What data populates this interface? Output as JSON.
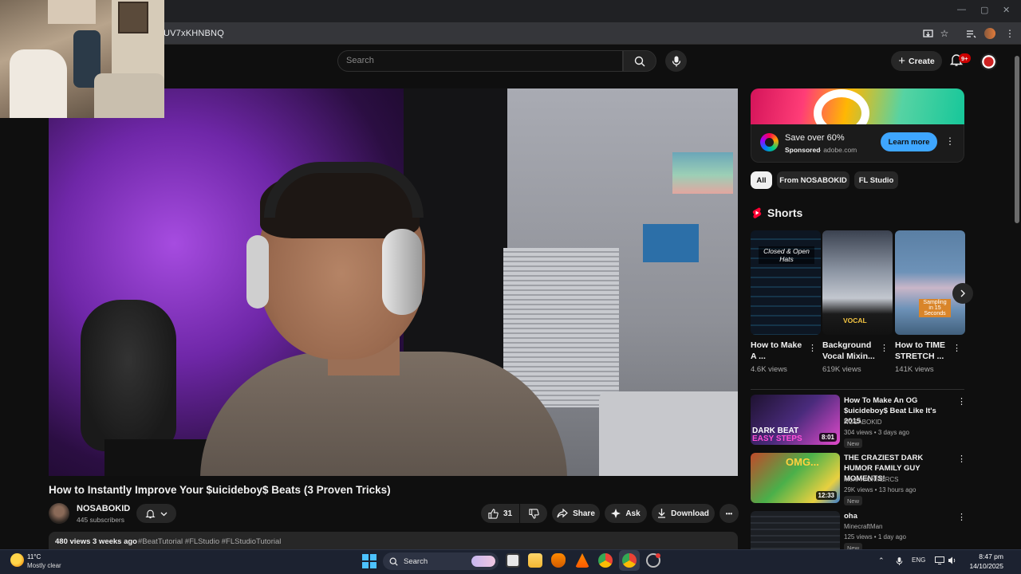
{
  "browser": {
    "url": "UV7xKHNBNQ",
    "window_controls": [
      "—",
      "▢",
      "✕"
    ]
  },
  "header": {
    "search_placeholder": "Search",
    "create_label": "Create",
    "notification_count": "9+"
  },
  "video": {
    "title": "How to Instantly Improve Your $uicideboy$ Beats (3 Proven Tricks)",
    "channel_name": "NOSABOKID",
    "subscribers": "445 subscribers",
    "likes": "31",
    "share_label": "Share",
    "ask_label": "Ask",
    "download_label": "Download",
    "more_label": "•••",
    "views_date": "480 views  3 weeks ago",
    "hashtags": "#BeatTutorial #FLStudio #FLStudioTutorial"
  },
  "ad": {
    "title": "Save over 60%",
    "sponsored": "Sponsored",
    "domain": "· adobe.com",
    "cta": "Learn more"
  },
  "chips": [
    "All",
    "From NOSABOKID",
    "FL Studio"
  ],
  "shorts": {
    "section_title": "Shorts",
    "items": [
      {
        "title": "How to Make A ...",
        "views": "4.6K views",
        "caption": "Closed & Open Hats"
      },
      {
        "title": "Background Vocal Mixin...",
        "views": "619K views",
        "caption": "VOCAL"
      },
      {
        "title": "How to TIME STRETCH ...",
        "views": "141K views",
        "caption": "Sampling in 15 Seconds"
      }
    ]
  },
  "recommended": [
    {
      "title": "How To Make An OG $uicideboy$ Beat Like It's 2015",
      "channel": "NOSABOKID",
      "meta": "304 views • 3 days ago",
      "badge": "New",
      "duration": "8:01",
      "thumb_text1": "DARK BEAT",
      "thumb_text2": "EASY STEPS"
    },
    {
      "title": "THE CRAZIEST DARK HUMOR FAMILY GUY MOMENTS!",
      "channel": "More NICKMERCS",
      "meta": "29K views • 13 hours ago",
      "badge": "New",
      "duration": "12:33",
      "thumb_text1": "OMG..."
    },
    {
      "title": "oha",
      "channel": "MinecraftMan",
      "meta": "125 views • 1 day ago",
      "badge": "New"
    }
  ],
  "taskbar": {
    "temperature": "11°C",
    "weather": "Mostly clear",
    "search_label": "Search",
    "language": "ENG",
    "time": "8:47 pm",
    "date": "14/10/2025"
  }
}
